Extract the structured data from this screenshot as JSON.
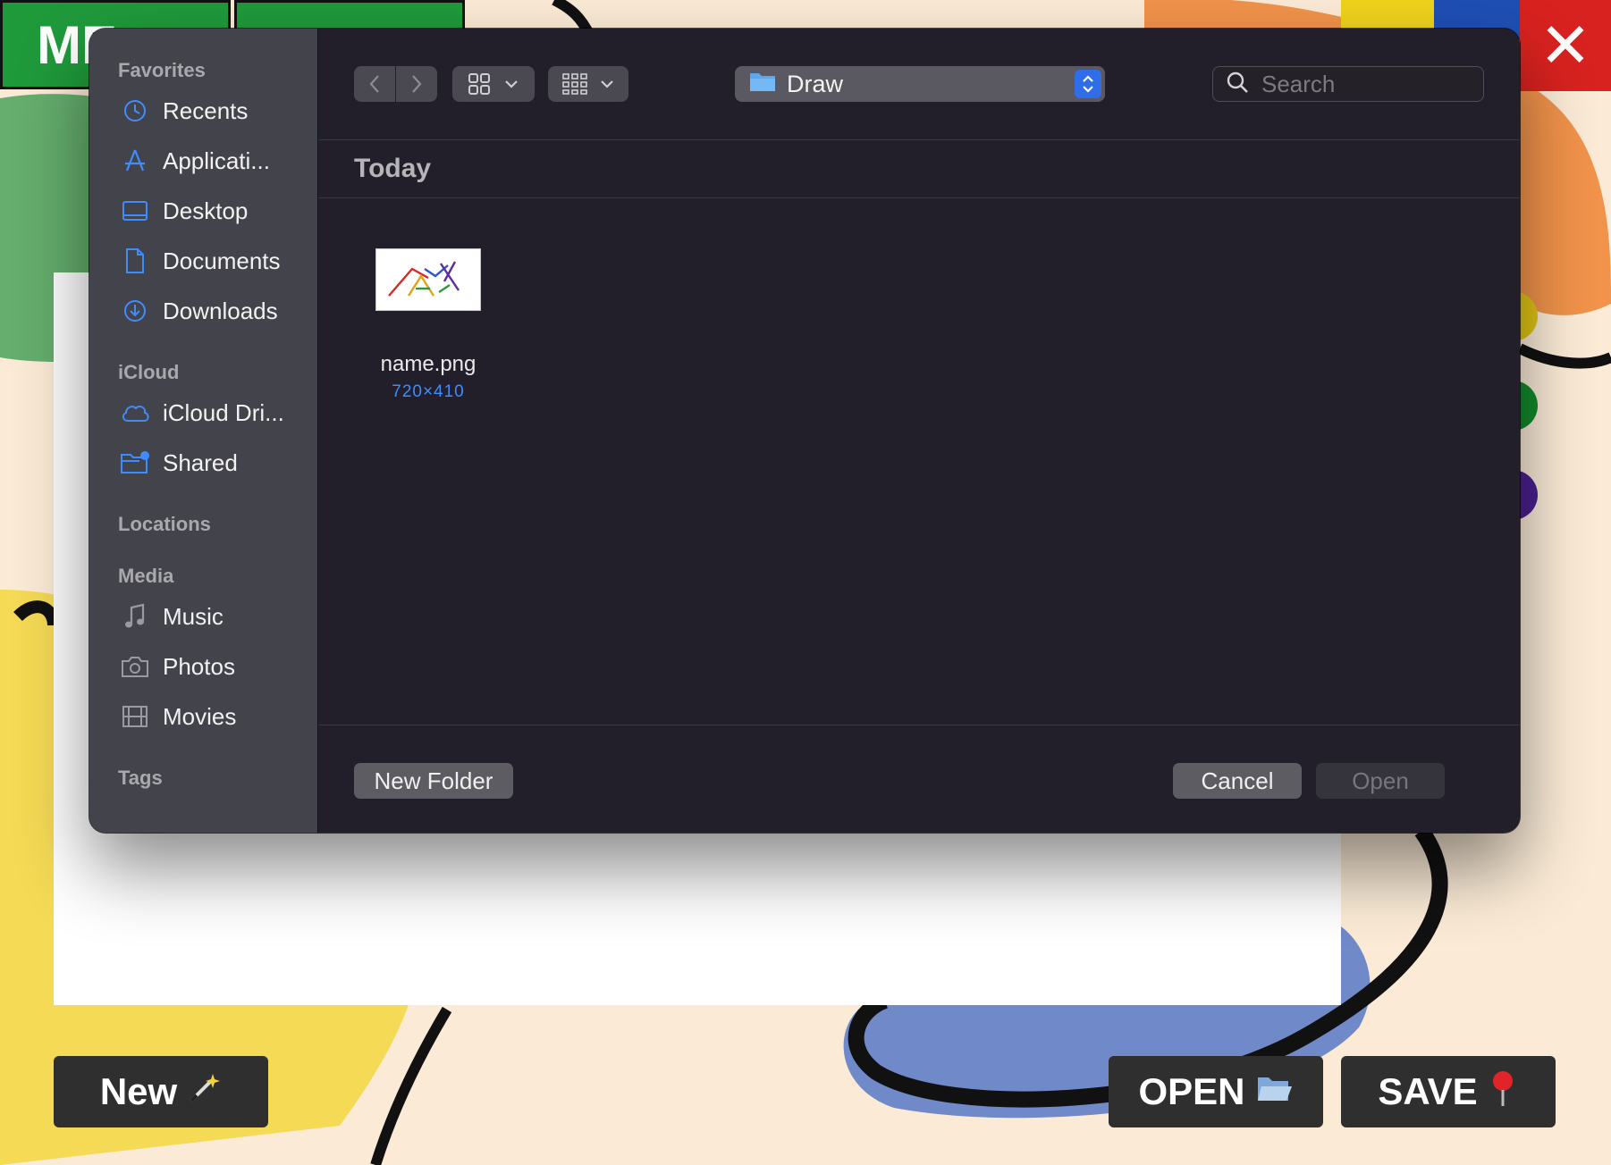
{
  "app": {
    "menu_label": "ME",
    "close_label": "✕",
    "bottom_buttons": {
      "new_label": "New",
      "new_icon": "magic-wand-icon",
      "open_label": "OPEN",
      "open_icon": "open-folder-icon",
      "save_label": "SAVE",
      "save_icon": "pushpin-icon"
    },
    "palette_colors": [
      "#e0c514",
      "#138a2c",
      "#4b1f8f"
    ]
  },
  "dialog": {
    "sidebar": {
      "sections": [
        {
          "title": "Favorites",
          "items": [
            {
              "label": "Recents",
              "icon": "clock-icon"
            },
            {
              "label": "Applicati...",
              "icon": "applications-icon"
            },
            {
              "label": "Desktop",
              "icon": "desktop-icon"
            },
            {
              "label": "Documents",
              "icon": "document-icon"
            },
            {
              "label": "Downloads",
              "icon": "download-icon"
            }
          ]
        },
        {
          "title": "iCloud",
          "items": [
            {
              "label": "iCloud Dri...",
              "icon": "cloud-icon"
            },
            {
              "label": "Shared",
              "icon": "shared-folder-icon"
            }
          ]
        },
        {
          "title": "Locations",
          "items": []
        },
        {
          "title": "Media",
          "items": [
            {
              "label": "Music",
              "icon": "music-note-icon"
            },
            {
              "label": "Photos",
              "icon": "camera-icon"
            },
            {
              "label": "Movies",
              "icon": "film-icon"
            }
          ]
        },
        {
          "title": "Tags",
          "items": []
        }
      ]
    },
    "toolbar": {
      "location": "Draw",
      "search_placeholder": "Search"
    },
    "group_header": "Today",
    "files": [
      {
        "name": "name.png",
        "dimensions": "720×410"
      }
    ],
    "footer": {
      "new_folder_label": "New Folder",
      "cancel_label": "Cancel",
      "open_label": "Open"
    },
    "colors": {
      "accent": "#2f6ee8",
      "sidebar_icon": "#3f8cff"
    }
  }
}
